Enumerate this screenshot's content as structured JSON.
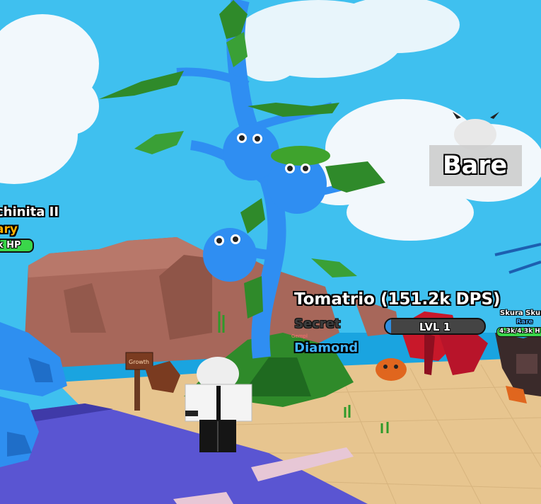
{
  "selected_pet": {
    "name_label": "Tomatrio (151.2k DPS)",
    "rarity": "Secret",
    "variant": "Diamond",
    "level_label": "LVL 1",
    "level_progress": 0.06
  },
  "player": {
    "name": "Bare"
  },
  "left_enemy": {
    "name": "chinita II",
    "rarity": "ary",
    "hp_label": "k HP"
  },
  "right_enemy": {
    "name": "Skura Skura",
    "rarity": "Rare",
    "hp_label": "4.3k/4.3k H"
  },
  "small_label": "Gempl",
  "sign_text": "Growth",
  "colors": {
    "sky": "#3fc0ef",
    "sand": "#e7c58f",
    "water": "#5a55d2",
    "plant_blue": "#2f8ef2",
    "leaf_green": "#2f8a2a",
    "diamond_text": "#3fb4ff",
    "hp_green": "#3ad64a"
  }
}
